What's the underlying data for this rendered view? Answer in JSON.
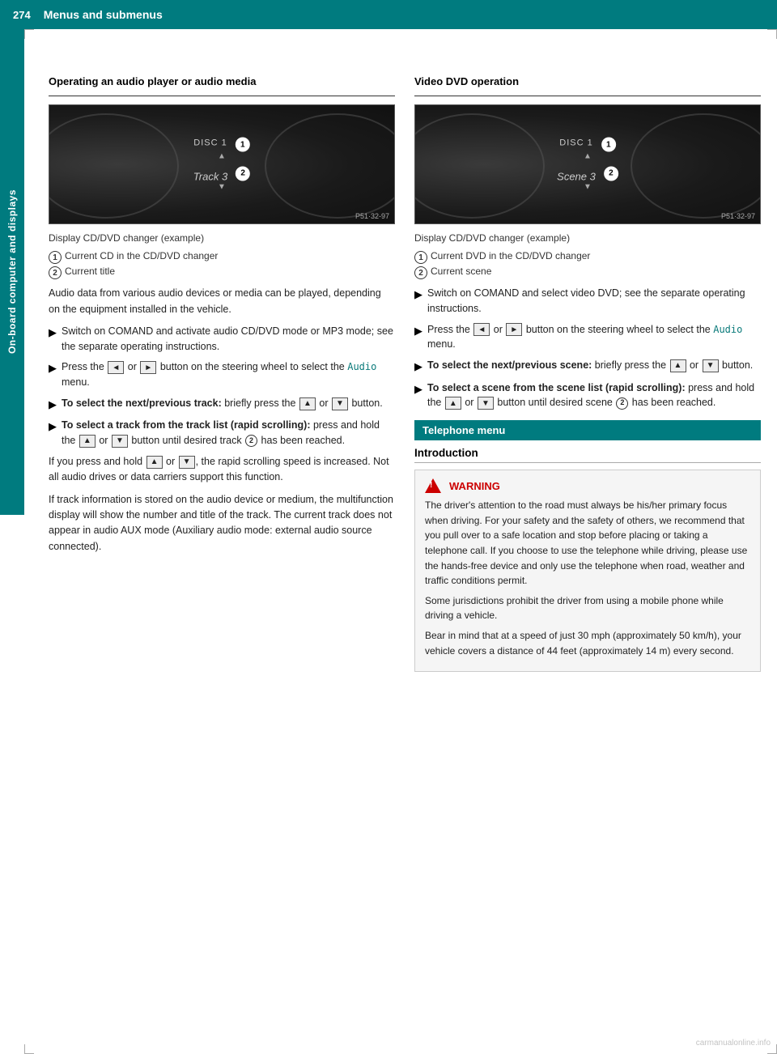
{
  "header": {
    "page_number": "274",
    "title": "Menus and submenus"
  },
  "side_tab": {
    "label": "On-board computer and displays"
  },
  "left_column": {
    "section_title": "Operating an audio player or audio media",
    "display_image": {
      "disc_label": "DISC 1",
      "track_label": "Track 3",
      "badge1": "1",
      "badge2": "2",
      "img_ref": "P51·32-97"
    },
    "caption_title": "Display CD/DVD changer (example)",
    "caption_items": [
      {
        "num": "1",
        "text": "Current CD in the CD/DVD changer"
      },
      {
        "num": "2",
        "text": "Current title"
      }
    ],
    "body_paragraphs": [
      "Audio data from various audio devices or media can be played, depending on the equipment installed in the vehicle."
    ],
    "bullets": [
      {
        "id": 1,
        "text": "Switch on COMAND and activate audio CD/DVD mode or MP3 mode; see the separate operating instructions."
      },
      {
        "id": 2,
        "text_parts": [
          "Press the ",
          "◄",
          " or ",
          "►",
          " button on the steering wheel to select the ",
          "Audio",
          " menu."
        ]
      },
      {
        "id": 3,
        "bold_prefix": "To select the next/previous track:",
        "text": " briefly press the ",
        "btn1": "▲",
        "btn2": "▼",
        "text2": " button."
      },
      {
        "id": 4,
        "bold_prefix": "To select a track from the track list (rapid scrolling):",
        "text": " press and hold the ",
        "btn1": "▲",
        "text2": " or ",
        "btn2": "▼",
        "text3": " button until desired track ",
        "circle": "2",
        "text4": " has been reached."
      }
    ],
    "rapid_scroll_note": "If you press and hold  ▲  or  ▼ , the rapid scrolling speed is increased. Not all audio drives or data carriers support this function.",
    "track_info_note": "If track information is stored on the audio device or medium, the multifunction display will show the number and title of the track. The current track does not appear in audio AUX mode (Auxiliary audio mode: external audio source connected)."
  },
  "right_column": {
    "section_title": "Video DVD operation",
    "display_image": {
      "disc_label": "DISC 1",
      "scene_label": "Scene 3",
      "badge1": "1",
      "badge2": "2",
      "img_ref": "P51·32-97"
    },
    "caption_title": "Display CD/DVD changer (example)",
    "caption_items": [
      {
        "num": "1",
        "text": "Current DVD in the CD/DVD changer"
      },
      {
        "num": "2",
        "text": "Current scene"
      }
    ],
    "bullets": [
      {
        "id": 1,
        "text": "Switch on COMAND and select video DVD; see the separate operating instructions."
      },
      {
        "id": 2,
        "text_parts": [
          "Press the ",
          "◄",
          " or ",
          "►",
          " button on the steering wheel to select the ",
          "Audio",
          " menu."
        ]
      },
      {
        "id": 3,
        "bold_prefix": "To select the next/previous scene:",
        "text": " briefly press the ",
        "btn1": "▲",
        "text2": " or ",
        "btn2": "▼",
        "text3": " button."
      },
      {
        "id": 4,
        "bold_prefix": "To select a scene from the scene list (rapid scrolling):",
        "text": " press and hold the ",
        "btn1": "▲",
        "text2": " or ",
        "btn2": "▼",
        "text3": " button until desired scene ",
        "circle": "2",
        "text4": " has been reached."
      }
    ],
    "telephone_section": {
      "header": "Telephone menu",
      "intro_title": "Introduction",
      "warning": {
        "title": "WARNING",
        "paragraphs": [
          "The driver's attention to the road must always be his/her primary focus when driving. For your safety and the safety of others, we recommend that you pull over to a safe location and stop before placing or taking a telephone call. If you choose to use the telephone while driving, please use the hands-free device and only use the telephone when road, weather and traffic conditions permit.",
          "Some jurisdictions prohibit the driver from using a mobile phone while driving a vehicle.",
          "Bear in mind that at a speed of just 30 mph (approximately 50 km/h), your vehicle covers a distance of 44 feet (approximately 14 m) every second."
        ]
      }
    }
  },
  "watermark": "carmanualonline.info"
}
